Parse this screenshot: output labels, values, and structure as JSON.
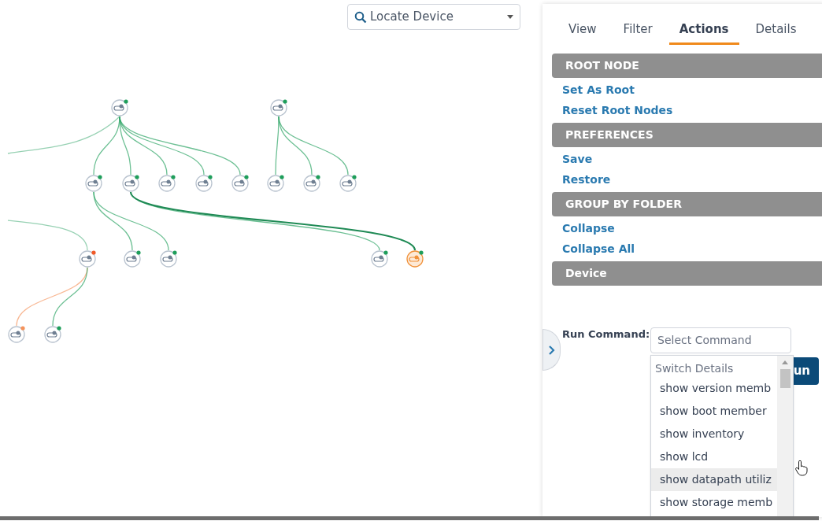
{
  "locate": {
    "placeholder": "Locate Device"
  },
  "tabs": [
    {
      "label": "View",
      "selected": false
    },
    {
      "label": "Filter",
      "selected": false
    },
    {
      "label": "Actions",
      "selected": true
    },
    {
      "label": "Details",
      "selected": false
    }
  ],
  "sections": [
    {
      "title": "ROOT NODE",
      "links": [
        "Set As Root",
        "Reset Root Nodes"
      ]
    },
    {
      "title": "PREFERENCES",
      "links": [
        "Save",
        "Restore"
      ]
    },
    {
      "title": "GROUP BY FOLDER",
      "links": [
        "Collapse",
        "Collapse All"
      ]
    },
    {
      "title": "Device"
    }
  ],
  "run_command": {
    "label": "Run Command:",
    "placeholder": "Select Command",
    "button": "un"
  },
  "dropdown": {
    "group": "Switch Details",
    "items": [
      {
        "label": "show version memb",
        "selected": false
      },
      {
        "label": "show boot member",
        "selected": false
      },
      {
        "label": "show inventory",
        "selected": false
      },
      {
        "label": "show lcd",
        "selected": false
      },
      {
        "label": "show datapath utiliz",
        "selected": true
      },
      {
        "label": "show storage memb",
        "selected": false
      }
    ]
  },
  "topology": [
    {
      "kind": "root",
      "color": "#1e9e5a",
      "selected": false,
      "children": [
        {
          "color": "#1e9e5a",
          "selected": false,
          "children": [
            {
              "color": "#1e9e5a",
              "selected": false
            },
            {
              "color": "#1e9e5a",
              "selected": false
            }
          ]
        },
        {
          "color": "#1e9e5a",
          "selected": false,
          "children": [
            {
              "color": "#1e9e5a",
              "selected": false
            },
            {
              "color": "#1e9e5a",
              "selected": true
            }
          ]
        },
        {
          "color": "#1e9e5a",
          "selected": false
        },
        {
          "color": "#1e9e5a",
          "selected": false
        },
        {
          "color": "#1e9e5a",
          "selected": false
        }
      ]
    },
    {
      "kind": "root",
      "color": "#1e9e5a",
      "selected": false,
      "children": [
        {
          "color": "#1e9e5a",
          "selected": false
        },
        {
          "color": "#1e9e5a",
          "selected": false
        },
        {
          "color": "#1e9e5a",
          "selected": false
        }
      ]
    },
    {
      "kind": "offscreen_parent",
      "color": "#f05a28",
      "selected": false,
      "children": [
        {
          "color": "#f5925a",
          "selected": false
        },
        {
          "color": "#1e9e5a",
          "selected": false
        }
      ]
    }
  ]
}
